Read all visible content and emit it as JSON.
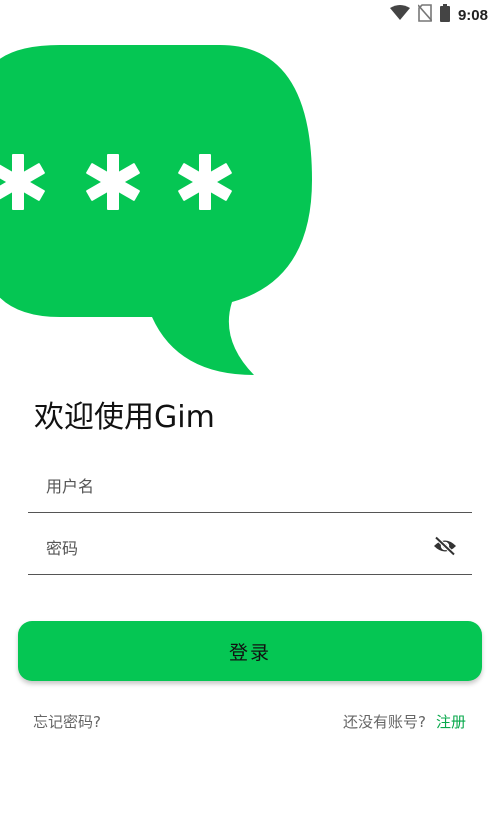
{
  "status_bar": {
    "time": "9:08",
    "icons": [
      "wifi-icon",
      "no-sim-icon",
      "battery-icon"
    ]
  },
  "hero": {
    "icon": "password-speech-bubble-icon",
    "color": "#05c653"
  },
  "welcome": {
    "title": "欢迎使用Gim"
  },
  "form": {
    "username_placeholder": "用户名",
    "username_value": "",
    "password_placeholder": "密码",
    "password_value": "",
    "password_toggle_icon": "eye-off-icon"
  },
  "login": {
    "label": "登录",
    "color": "#05c653"
  },
  "footer": {
    "forgot_label": "忘记密码?",
    "no_account_label": "还没有账号?",
    "register_label": "注册",
    "register_color": "#07a84b"
  }
}
